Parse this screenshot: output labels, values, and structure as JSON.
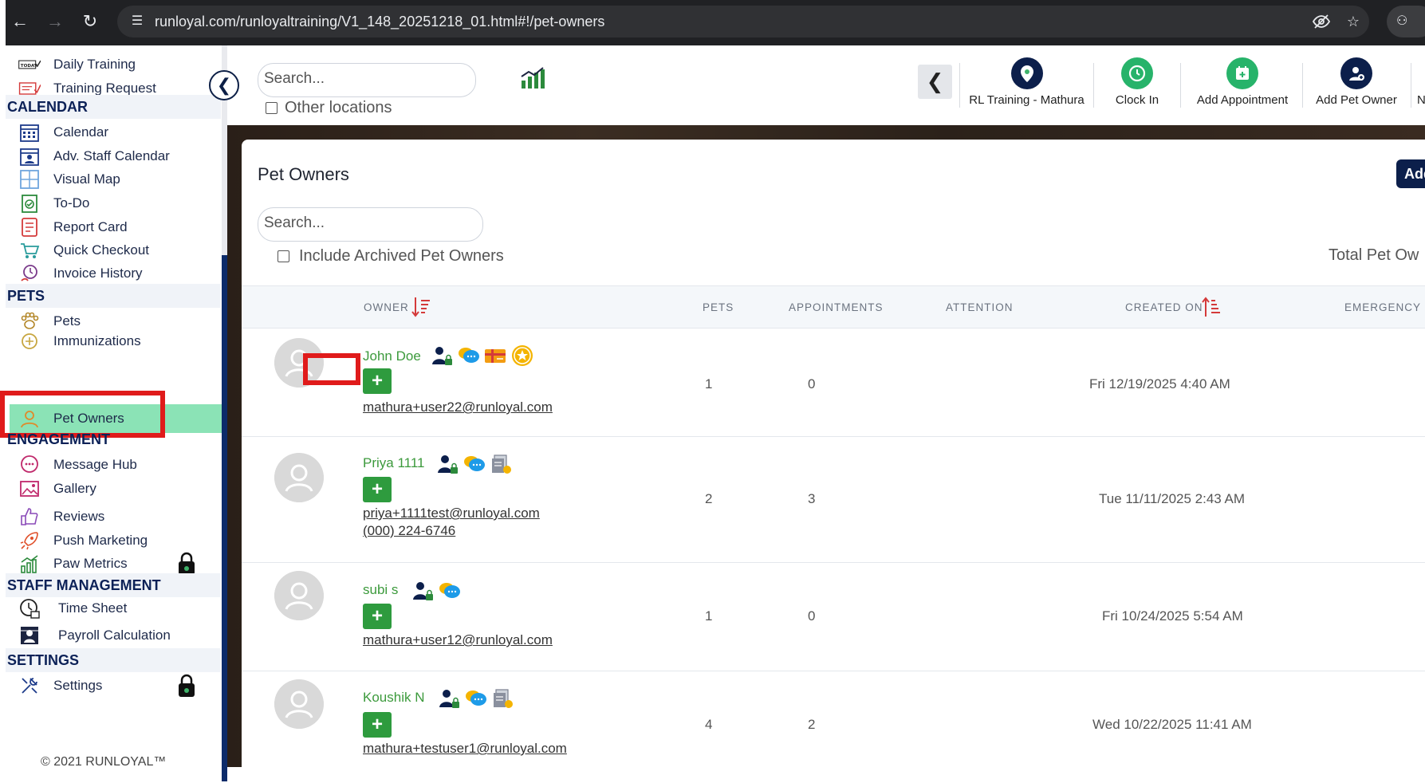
{
  "browser": {
    "url": "runloyal.com/runloyaltraining/V1_148_20251218_01.html#!/pet-owners"
  },
  "sidebar": {
    "items": [
      {
        "label": "Daily Training",
        "icon": "today-icon"
      },
      {
        "label": "Training Request",
        "icon": "training-request-icon"
      },
      {
        "label": "Calendar",
        "icon": "calendar-icon"
      },
      {
        "label": "Adv. Staff Calendar",
        "icon": "staff-calendar-icon"
      },
      {
        "label": "Visual Map",
        "icon": "visual-map-icon"
      },
      {
        "label": "To-Do",
        "icon": "todo-icon"
      },
      {
        "label": "Report Card",
        "icon": "report-card-icon"
      },
      {
        "label": "Quick Checkout",
        "icon": "cart-icon"
      },
      {
        "label": "Invoice History",
        "icon": "invoice-icon"
      },
      {
        "label": "Pets",
        "icon": "paw-icon"
      },
      {
        "label": "Immunizations",
        "icon": "immunization-icon"
      },
      {
        "label": "Pet Owners",
        "icon": "person-icon"
      },
      {
        "label": "Message Hub",
        "icon": "message-icon"
      },
      {
        "label": "Gallery",
        "icon": "gallery-icon"
      },
      {
        "label": "Reviews",
        "icon": "thumbs-up-icon"
      },
      {
        "label": "Push Marketing",
        "icon": "rocket-icon"
      },
      {
        "label": "Paw Metrics",
        "icon": "metrics-icon"
      },
      {
        "label": "Time Sheet",
        "icon": "clock-icon"
      },
      {
        "label": "Payroll Calculation",
        "icon": "payroll-icon"
      },
      {
        "label": "Settings",
        "icon": "settings-icon"
      }
    ],
    "headers": {
      "calendar": "CALENDAR",
      "pets": "PETS",
      "engagement": "ENGAGEMENT",
      "staff": "STAFF MANAGEMENT",
      "settings": "SETTINGS"
    },
    "copyright": "© 2021 RUNLOYAL™"
  },
  "topbar": {
    "search_placeholder": "Search...",
    "other_locations": "Other locations",
    "actions": [
      {
        "label": "RL Training - Mathura",
        "color": "#0c1f4b"
      },
      {
        "label": "Clock In",
        "color": "#27b36a"
      },
      {
        "label": "Add Appointment",
        "color": "#27b36a"
      },
      {
        "label": "Add Pet Owner",
        "color": "#0c1f4b"
      },
      {
        "label": "Notifications",
        "color": "#e8343e"
      }
    ]
  },
  "page": {
    "title": "Pet Owners",
    "add_button": "Add",
    "search_placeholder": "Search...",
    "include_archived": "Include Archived Pet Owners",
    "total_label": "Total Pet Ow"
  },
  "table": {
    "headers": [
      "OWNER",
      "PETS",
      "APPOINTMENTS",
      "ATTENTION",
      "CREATED ON",
      "EMERGENCY D"
    ],
    "rows": [
      {
        "name": "John Doe",
        "email": "mathura+user22@runloyal.com",
        "phone": "",
        "pets": "1",
        "appointments": "0",
        "created": "Fri 12/19/2025 4:40 AM"
      },
      {
        "name": "Priya 1111",
        "email": "priya+1111test@runloyal.com",
        "phone": "(000) 224-6746",
        "pets": "2",
        "appointments": "3",
        "created": "Tue 11/11/2025 2:43 AM"
      },
      {
        "name": "subi s",
        "email": "mathura+user12@runloyal.com",
        "phone": "",
        "pets": "1",
        "appointments": "0",
        "created": "Fri 10/24/2025 5:54 AM"
      },
      {
        "name": "Koushik N",
        "email": "mathura+testuser1@runloyal.com",
        "phone": "",
        "pets": "4",
        "appointments": "2",
        "created": "Wed 10/22/2025 11:41 AM"
      }
    ]
  },
  "plus_label": "+",
  "colors": {
    "navy": "#0c1f4b",
    "green": "#2e9b3e",
    "active": "#8be3b6",
    "highlight": "#e01b1b"
  }
}
